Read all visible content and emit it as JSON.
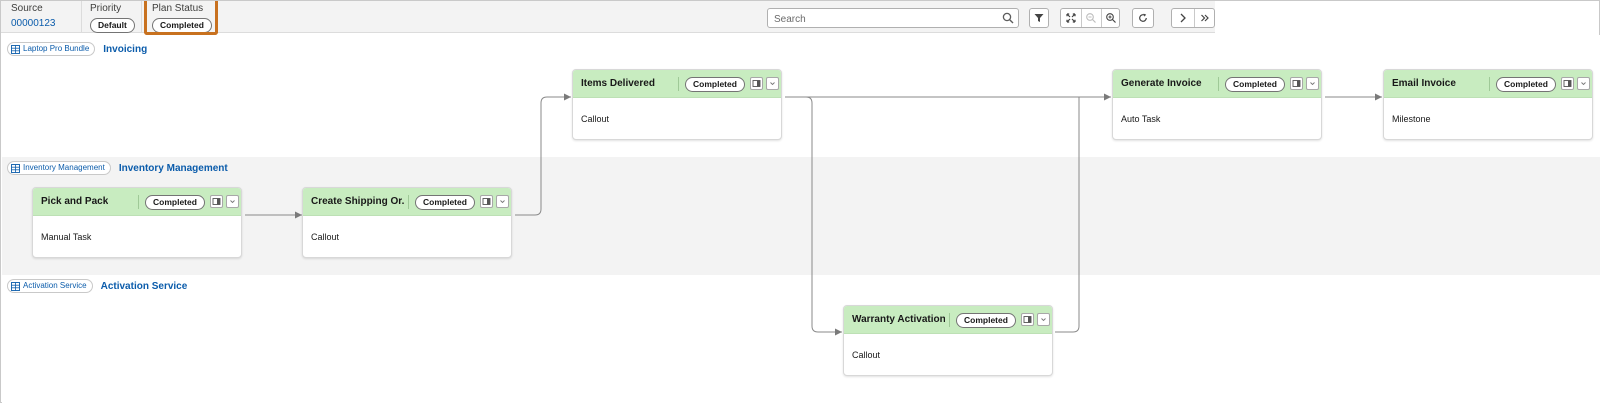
{
  "header": {
    "source_label": "Source",
    "source_value": "00000123",
    "priority_label": "Priority",
    "priority_value": "Default",
    "plan_status_label": "Plan Status",
    "plan_status_value": "Completed",
    "search_placeholder": "Search"
  },
  "toolbar": {
    "filter_icon": "filter-icon",
    "fit_icon": "fit-to-screen-icon",
    "zoom_out_icon": "zoom-out-icon",
    "zoom_in_icon": "zoom-in-icon",
    "refresh_icon": "refresh-icon",
    "next_icon": "chevron-right-icon",
    "last_icon": "double-chevron-right-icon"
  },
  "lanes": [
    {
      "tag": "Laptop Pro Bundle",
      "name": "Invoicing"
    },
    {
      "tag": "Inventory Management",
      "name": "Inventory Management"
    },
    {
      "tag": "Activation Service",
      "name": "Activation Service"
    }
  ],
  "cards": [
    {
      "title": "Items Delivered",
      "status": "Completed",
      "type": "Callout"
    },
    {
      "title": "Generate Invoice",
      "status": "Completed",
      "type": "Auto Task"
    },
    {
      "title": "Email Invoice",
      "status": "Completed",
      "type": "Milestone"
    },
    {
      "title": "Pick and Pack",
      "status": "Completed",
      "type": "Manual Task"
    },
    {
      "title": "Create Shipping Or...",
      "status": "Completed",
      "type": "Callout"
    },
    {
      "title": "Warranty Activation",
      "status": "Completed",
      "type": "Callout"
    }
  ],
  "colors": {
    "card_header": "#c8ecc0",
    "link": "#0b5cab",
    "highlight": "#c8711f"
  }
}
